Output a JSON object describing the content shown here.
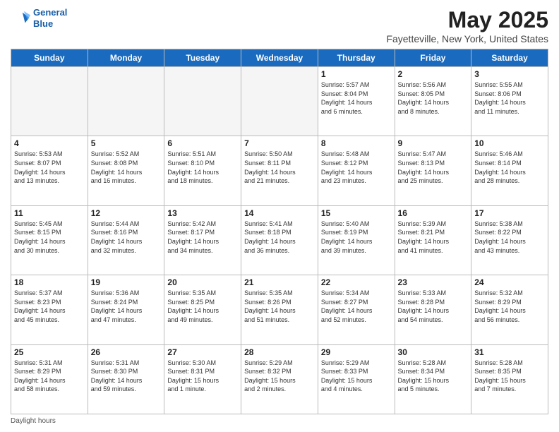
{
  "logo": {
    "line1": "General",
    "line2": "Blue"
  },
  "title": "May 2025",
  "subtitle": "Fayetteville, New York, United States",
  "days_of_week": [
    "Sunday",
    "Monday",
    "Tuesday",
    "Wednesday",
    "Thursday",
    "Friday",
    "Saturday"
  ],
  "footer": "Daylight hours",
  "weeks": [
    [
      {
        "day": "",
        "info": ""
      },
      {
        "day": "",
        "info": ""
      },
      {
        "day": "",
        "info": ""
      },
      {
        "day": "",
        "info": ""
      },
      {
        "day": "1",
        "info": "Sunrise: 5:57 AM\nSunset: 8:04 PM\nDaylight: 14 hours\nand 6 minutes."
      },
      {
        "day": "2",
        "info": "Sunrise: 5:56 AM\nSunset: 8:05 PM\nDaylight: 14 hours\nand 8 minutes."
      },
      {
        "day": "3",
        "info": "Sunrise: 5:55 AM\nSunset: 8:06 PM\nDaylight: 14 hours\nand 11 minutes."
      }
    ],
    [
      {
        "day": "4",
        "info": "Sunrise: 5:53 AM\nSunset: 8:07 PM\nDaylight: 14 hours\nand 13 minutes."
      },
      {
        "day": "5",
        "info": "Sunrise: 5:52 AM\nSunset: 8:08 PM\nDaylight: 14 hours\nand 16 minutes."
      },
      {
        "day": "6",
        "info": "Sunrise: 5:51 AM\nSunset: 8:10 PM\nDaylight: 14 hours\nand 18 minutes."
      },
      {
        "day": "7",
        "info": "Sunrise: 5:50 AM\nSunset: 8:11 PM\nDaylight: 14 hours\nand 21 minutes."
      },
      {
        "day": "8",
        "info": "Sunrise: 5:48 AM\nSunset: 8:12 PM\nDaylight: 14 hours\nand 23 minutes."
      },
      {
        "day": "9",
        "info": "Sunrise: 5:47 AM\nSunset: 8:13 PM\nDaylight: 14 hours\nand 25 minutes."
      },
      {
        "day": "10",
        "info": "Sunrise: 5:46 AM\nSunset: 8:14 PM\nDaylight: 14 hours\nand 28 minutes."
      }
    ],
    [
      {
        "day": "11",
        "info": "Sunrise: 5:45 AM\nSunset: 8:15 PM\nDaylight: 14 hours\nand 30 minutes."
      },
      {
        "day": "12",
        "info": "Sunrise: 5:44 AM\nSunset: 8:16 PM\nDaylight: 14 hours\nand 32 minutes."
      },
      {
        "day": "13",
        "info": "Sunrise: 5:42 AM\nSunset: 8:17 PM\nDaylight: 14 hours\nand 34 minutes."
      },
      {
        "day": "14",
        "info": "Sunrise: 5:41 AM\nSunset: 8:18 PM\nDaylight: 14 hours\nand 36 minutes."
      },
      {
        "day": "15",
        "info": "Sunrise: 5:40 AM\nSunset: 8:19 PM\nDaylight: 14 hours\nand 39 minutes."
      },
      {
        "day": "16",
        "info": "Sunrise: 5:39 AM\nSunset: 8:21 PM\nDaylight: 14 hours\nand 41 minutes."
      },
      {
        "day": "17",
        "info": "Sunrise: 5:38 AM\nSunset: 8:22 PM\nDaylight: 14 hours\nand 43 minutes."
      }
    ],
    [
      {
        "day": "18",
        "info": "Sunrise: 5:37 AM\nSunset: 8:23 PM\nDaylight: 14 hours\nand 45 minutes."
      },
      {
        "day": "19",
        "info": "Sunrise: 5:36 AM\nSunset: 8:24 PM\nDaylight: 14 hours\nand 47 minutes."
      },
      {
        "day": "20",
        "info": "Sunrise: 5:35 AM\nSunset: 8:25 PM\nDaylight: 14 hours\nand 49 minutes."
      },
      {
        "day": "21",
        "info": "Sunrise: 5:35 AM\nSunset: 8:26 PM\nDaylight: 14 hours\nand 51 minutes."
      },
      {
        "day": "22",
        "info": "Sunrise: 5:34 AM\nSunset: 8:27 PM\nDaylight: 14 hours\nand 52 minutes."
      },
      {
        "day": "23",
        "info": "Sunrise: 5:33 AM\nSunset: 8:28 PM\nDaylight: 14 hours\nand 54 minutes."
      },
      {
        "day": "24",
        "info": "Sunrise: 5:32 AM\nSunset: 8:29 PM\nDaylight: 14 hours\nand 56 minutes."
      }
    ],
    [
      {
        "day": "25",
        "info": "Sunrise: 5:31 AM\nSunset: 8:29 PM\nDaylight: 14 hours\nand 58 minutes."
      },
      {
        "day": "26",
        "info": "Sunrise: 5:31 AM\nSunset: 8:30 PM\nDaylight: 14 hours\nand 59 minutes."
      },
      {
        "day": "27",
        "info": "Sunrise: 5:30 AM\nSunset: 8:31 PM\nDaylight: 15 hours\nand 1 minute."
      },
      {
        "day": "28",
        "info": "Sunrise: 5:29 AM\nSunset: 8:32 PM\nDaylight: 15 hours\nand 2 minutes."
      },
      {
        "day": "29",
        "info": "Sunrise: 5:29 AM\nSunset: 8:33 PM\nDaylight: 15 hours\nand 4 minutes."
      },
      {
        "day": "30",
        "info": "Sunrise: 5:28 AM\nSunset: 8:34 PM\nDaylight: 15 hours\nand 5 minutes."
      },
      {
        "day": "31",
        "info": "Sunrise: 5:28 AM\nSunset: 8:35 PM\nDaylight: 15 hours\nand 7 minutes."
      }
    ]
  ]
}
